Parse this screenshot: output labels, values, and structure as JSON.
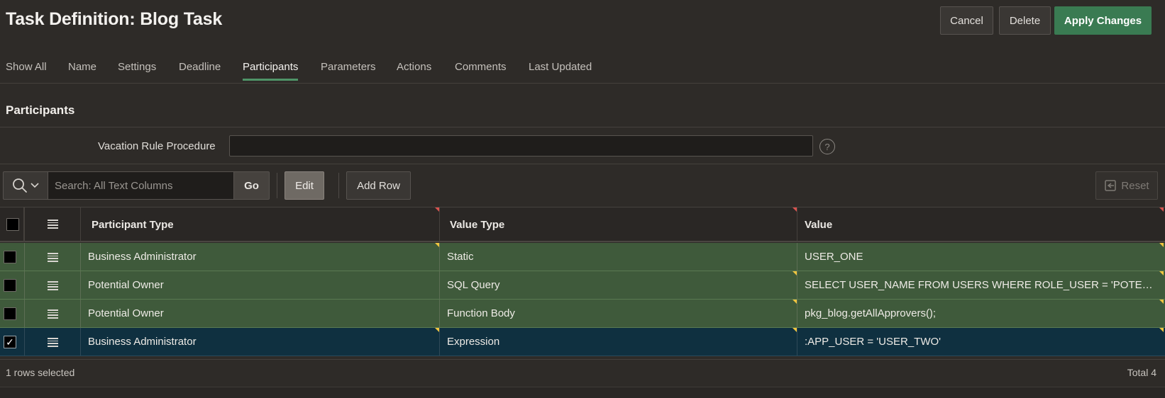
{
  "header": {
    "title": "Task Definition: Blog Task",
    "cancel_label": "Cancel",
    "delete_label": "Delete",
    "apply_label": "Apply Changes"
  },
  "tabs": [
    {
      "label": "Show All"
    },
    {
      "label": "Name"
    },
    {
      "label": "Settings"
    },
    {
      "label": "Deadline"
    },
    {
      "label": "Participants",
      "active": true
    },
    {
      "label": "Parameters"
    },
    {
      "label": "Actions"
    },
    {
      "label": "Comments"
    },
    {
      "label": "Last Updated"
    }
  ],
  "region": {
    "title": "Participants",
    "vacation_label": "Vacation Rule Procedure",
    "vacation_value": "",
    "help_glyph": "?"
  },
  "toolbar": {
    "search_placeholder": "Search: All Text Columns",
    "go_label": "Go",
    "edit_label": "Edit",
    "add_row_label": "Add Row",
    "reset_label": "Reset"
  },
  "grid": {
    "columns": [
      "Participant Type",
      "Value Type",
      "Value"
    ],
    "rows": [
      {
        "participant_type": "Business Administrator",
        "value_type": "Static",
        "value": "USER_ONE",
        "selected": false
      },
      {
        "participant_type": "Potential Owner",
        "value_type": "SQL Query",
        "value": "SELECT USER_NAME FROM USERS WHERE ROLE_USER = 'POTENTIA...",
        "selected": false
      },
      {
        "participant_type": "Potential Owner",
        "value_type": "Function Body",
        "value": "pkg_blog.getAllApprovers();",
        "selected": false
      },
      {
        "participant_type": "Business Administrator",
        "value_type": "Expression",
        "value": ":APP_USER = 'USER_TWO'",
        "selected": true
      }
    ]
  },
  "footer": {
    "selection_text": "1 rows selected",
    "total_text": "Total 4"
  },
  "colors": {
    "primary": "#3a7b52",
    "changed_row": "#3f5a3b",
    "selected_row": "#0f3040",
    "tab_underline": "#4f9468"
  }
}
